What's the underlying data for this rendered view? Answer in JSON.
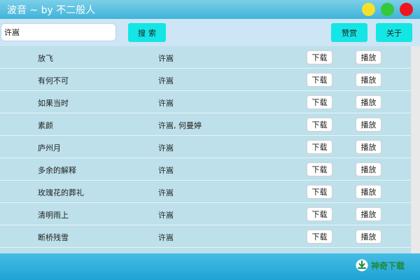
{
  "window": {
    "title": "波音 ~ by 不二般人"
  },
  "toolbar": {
    "search_value": "许嵩",
    "search_button": "搜索",
    "heart_button": "赞赏",
    "about_button": "关于"
  },
  "list": {
    "download_label": "下载",
    "play_label": "播放",
    "rows": [
      {
        "song": "放飞",
        "artist": "许嵩"
      },
      {
        "song": "有何不可",
        "artist": "许嵩"
      },
      {
        "song": "如果当时",
        "artist": "许嵩"
      },
      {
        "song": "素颜",
        "artist": "许嵩, 何曼婷"
      },
      {
        "song": "庐州月",
        "artist": "许嵩"
      },
      {
        "song": "多余的解释",
        "artist": "许嵩"
      },
      {
        "song": "玫瑰花的葬礼",
        "artist": "许嵩"
      },
      {
        "song": "清明雨上",
        "artist": "许嵩"
      },
      {
        "song": "断桥残雪",
        "artist": "许嵩"
      }
    ]
  },
  "watermark": {
    "text": "神奇下载",
    "color": "#1b8a3a"
  },
  "colors": {
    "titlebar": "#3fb3d9",
    "accent_button": "#14e6e6",
    "list_background": "#bde0ea",
    "min_button": "#f5e02a",
    "max_button": "#34c93a",
    "close_button": "#f0141e"
  }
}
